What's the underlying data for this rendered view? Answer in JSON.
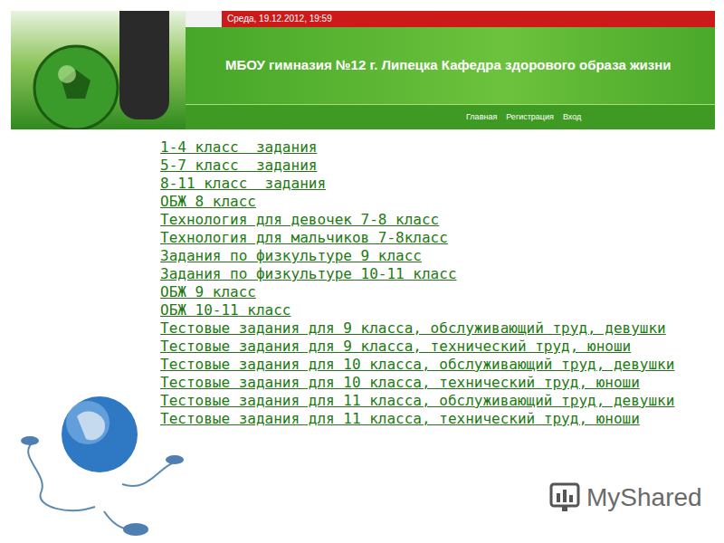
{
  "header": {
    "date": "Среда, 19.12.2012, 19:59",
    "title": "МБОУ гимназия №12 г. Липецка Кафедра здорового образа жизни"
  },
  "nav": [
    "Главная",
    "Регистрация",
    "Вход"
  ],
  "links": [
    "1-4 класс  задания",
    "5-7 класс  задания",
    "8-11 класс  задания",
    "ОБЖ 8 класс",
    "Технология для девочек 7-8 класс",
    "Технология для мальчиков 7-8класс",
    "Задания по физкультуре 9 класс",
    "Задания по физкультуре 10-11 класс",
    "ОБЖ 9 класс",
    "ОБЖ 10-11 класс",
    "Тестовые задания для 9 класса, обслуживающий труд, девушки",
    "Тестовые задания для 9 класса, технический труд, юноши",
    "Тестовые задания для 10 класса, обслуживающий труд, девушки",
    "Тестовые задания для 10 класса, технический труд, юноши",
    "Тестовые задания для 11 класса, обслуживающий труд, девушки",
    "Тестовые задания для 11 класса, технический труд, юноши"
  ],
  "watermark": "MyShared"
}
